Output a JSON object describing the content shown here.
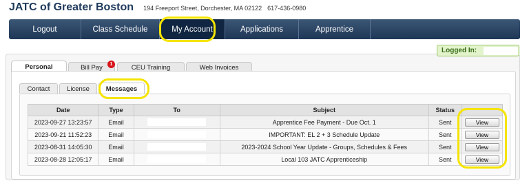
{
  "header": {
    "title": "JATC of Greater Boston",
    "address": "194 Freeport Street, Dorchester, MA 02122",
    "phone": "617-436-0980"
  },
  "nav": {
    "items": [
      {
        "label": "Logout"
      },
      {
        "label": "Class Schedule"
      },
      {
        "label": "My Account"
      },
      {
        "label": "Applications"
      },
      {
        "label": "Apprentice"
      }
    ],
    "active": "My Account"
  },
  "logged_in": {
    "label": "Logged In:"
  },
  "tabs": [
    {
      "label": "Personal"
    },
    {
      "label": "Bill Pay",
      "badge": "1"
    },
    {
      "label": "CEU Training"
    },
    {
      "label": "Web Invoices"
    }
  ],
  "subtabs": [
    {
      "label": "Contact"
    },
    {
      "label": "License"
    },
    {
      "label": "Messages"
    }
  ],
  "messages": {
    "columns": [
      "Date",
      "Type",
      "To",
      "Subject",
      "Status",
      ""
    ],
    "rows": [
      {
        "date": "2023-09-27 13:23:57",
        "type": "Email",
        "subject": "Apprentice Fee Payment - Due Oct. 1",
        "status": "Sent",
        "action": "View"
      },
      {
        "date": "2023-09-21 11:52:23",
        "type": "Email",
        "subject": "IMPORTANT: EL 2 + 3 Schedule Update",
        "status": "Sent",
        "action": "View"
      },
      {
        "date": "2023-08-31 14:05:30",
        "type": "Email",
        "subject": "2023-2024 School Year Update - Groups, Schedules & Fees",
        "status": "Sent",
        "action": "View"
      },
      {
        "date": "2023-08-28 12:05:17",
        "type": "Email",
        "subject": "Local 103 JATC Apprenticeship",
        "status": "Sent",
        "action": "View"
      }
    ]
  }
}
